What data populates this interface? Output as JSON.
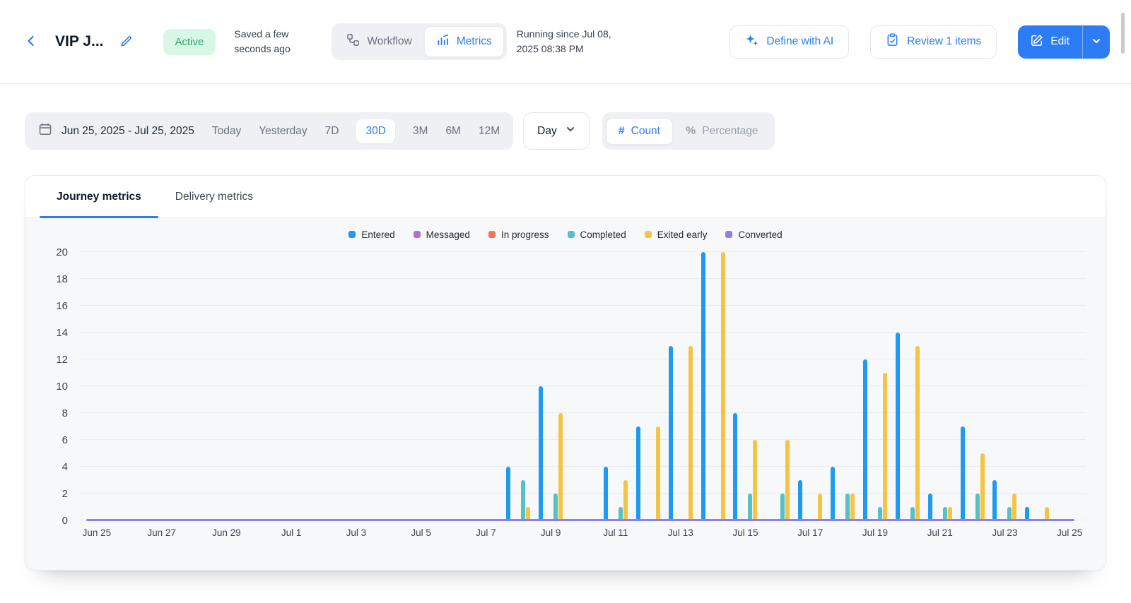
{
  "header": {
    "title": "VIP J...",
    "status_badge": "Active",
    "saved_text": "Saved a few seconds ago",
    "view_toggle": {
      "workflow_label": "Workflow",
      "metrics_label": "Metrics",
      "selected": "Metrics"
    },
    "running_since": "Running since Jul 08, 2025 08:38 PM",
    "define_ai_label": "Define with AI",
    "review_label": "Review 1 items",
    "edit_label": "Edit"
  },
  "filters": {
    "date_range": "Jun 25, 2025 - Jul 25, 2025",
    "presets": [
      "Today",
      "Yesterday",
      "7D",
      "30D",
      "3M",
      "6M",
      "12M"
    ],
    "selected_preset": "30D",
    "granularity": "Day",
    "value_mode": {
      "count_label": "Count",
      "percentage_label": "Percentage",
      "selected": "Count"
    }
  },
  "icons": {
    "hash": "#",
    "percent": "%"
  },
  "tabs": [
    {
      "label": "Journey metrics",
      "active": true
    },
    {
      "label": "Delivery metrics",
      "active": false
    }
  ],
  "colors": {
    "accent_blue": "#2b7cf5",
    "active_green_text": "#1fa968",
    "active_green_bg": "#d9f7e7"
  },
  "chart_data": {
    "type": "bar",
    "title": "Journey metrics",
    "xlabel": "",
    "ylabel": "",
    "ylim": [
      0,
      20
    ],
    "ytick_step": 2,
    "grid": true,
    "legend_position": "top",
    "categories": [
      "Jun 25",
      "Jun 26",
      "Jun 27",
      "Jun 28",
      "Jun 29",
      "Jun 30",
      "Jul 1",
      "Jul 2",
      "Jul 3",
      "Jul 4",
      "Jul 5",
      "Jul 6",
      "Jul 7",
      "Jul 8",
      "Jul 9",
      "Jul 10",
      "Jul 11",
      "Jul 12",
      "Jul 13",
      "Jul 14",
      "Jul 15",
      "Jul 16",
      "Jul 17",
      "Jul 18",
      "Jul 19",
      "Jul 20",
      "Jul 21",
      "Jul 22",
      "Jul 23",
      "Jul 24",
      "Jul 25"
    ],
    "xtick_labels": [
      "Jun 25",
      "Jun 27",
      "Jun 29",
      "Jul 1",
      "Jul 3",
      "Jul 5",
      "Jul 7",
      "Jul 9",
      "Jul 11",
      "Jul 13",
      "Jul 15",
      "Jul 17",
      "Jul 19",
      "Jul 21",
      "Jul 23",
      "Jul 25"
    ],
    "series": [
      {
        "name": "Entered",
        "color": "#1e9bf0",
        "values": [
          0,
          0,
          0,
          0,
          0,
          0,
          0,
          0,
          0,
          0,
          0,
          0,
          0,
          4,
          10,
          0,
          4,
          7,
          13,
          20,
          8,
          0,
          3,
          4,
          12,
          14,
          2,
          7,
          3,
          1,
          0
        ]
      },
      {
        "name": "Messaged",
        "color": "#b06fd8",
        "values": [
          0,
          0,
          0,
          0,
          0,
          0,
          0,
          0,
          0,
          0,
          0,
          0,
          0,
          0,
          0,
          0,
          0,
          0,
          0,
          0,
          0,
          0,
          0,
          0,
          0,
          0,
          0,
          0,
          0,
          0,
          0
        ]
      },
      {
        "name": "In progress",
        "color": "#f4735a",
        "values": [
          0,
          0,
          0,
          0,
          0,
          0,
          0,
          0,
          0,
          0,
          0,
          0,
          0,
          0,
          0,
          0,
          0,
          0,
          0,
          0,
          0,
          0,
          0,
          0,
          0,
          0,
          0,
          0,
          0,
          0,
          0
        ]
      },
      {
        "name": "Completed",
        "color": "#56c1c4",
        "values": [
          0,
          0,
          0,
          0,
          0,
          0,
          0,
          0,
          0,
          0,
          0,
          0,
          0,
          3,
          2,
          0,
          1,
          0,
          0,
          0,
          2,
          2,
          0,
          2,
          1,
          1,
          1,
          2,
          1,
          0,
          0
        ]
      },
      {
        "name": "Exited early",
        "color": "#f6c444",
        "values": [
          0,
          0,
          0,
          0,
          0,
          0,
          0,
          0,
          0,
          0,
          0,
          0,
          0,
          1,
          8,
          0,
          3,
          7,
          13,
          20,
          6,
          6,
          2,
          2,
          11,
          13,
          1,
          5,
          2,
          1,
          0
        ]
      },
      {
        "name": "Converted",
        "color": "#8b7ff2",
        "render_as_line": true,
        "values": [
          0,
          0,
          0,
          0,
          0,
          0,
          0,
          0,
          0,
          0,
          0,
          0,
          0,
          0,
          0,
          0,
          0,
          0,
          0,
          0,
          0,
          0,
          0,
          0,
          0,
          0,
          0,
          0,
          0,
          0,
          0
        ]
      }
    ]
  }
}
